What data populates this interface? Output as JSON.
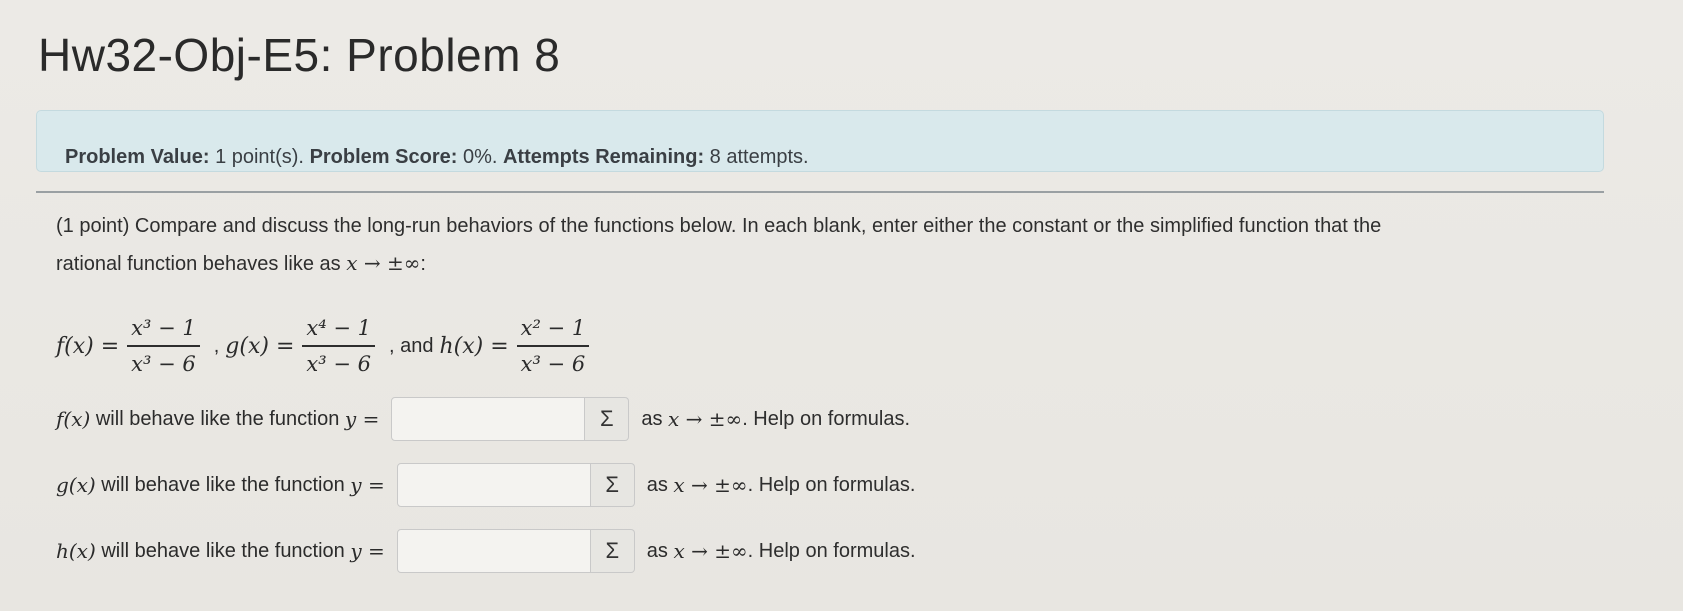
{
  "page_title": "Hw32-Obj-E5: Problem 8",
  "info": {
    "value_label": "Problem Value:",
    "value_text": "1 point(s).",
    "score_label": "Problem Score:",
    "score_text": "0%.",
    "attempts_label": "Attempts Remaining:",
    "attempts_text": "8 attempts."
  },
  "prompt": {
    "line1": "(1 point) Compare and discuss the long-run behaviors of the functions below. In each blank, enter either the constant or the simplified function that the",
    "line2_text": "rational function behaves like as ",
    "line2_math": "x → ±∞",
    "line2_end": ":"
  },
  "functions": {
    "f_lhs": "f(x) =",
    "f_num": "x³ − 1",
    "f_den": "x³ − 6",
    "g_lhs": "g(x) =",
    "g_num": "x⁴ − 1",
    "g_den": "x³ − 6",
    "h_lhs": "h(x) =",
    "h_num": "x² − 1",
    "h_den": "x³ − 6",
    "sep1": ",",
    "sep2": ", and"
  },
  "answers": [
    {
      "func": "f(x)",
      "label": "will behave like the function",
      "y_eq": "y =",
      "value": "",
      "sigma": "Σ",
      "as_text": "as",
      "limit": "x → ±∞",
      "help": ". Help on formulas."
    },
    {
      "func": "g(x)",
      "label": "will behave like the function",
      "y_eq": "y =",
      "value": "",
      "sigma": "Σ",
      "as_text": "as",
      "limit": "x → ±∞",
      "help": ". Help on formulas."
    },
    {
      "func": "h(x)",
      "label": "will behave like the function",
      "y_eq": "y =",
      "value": "",
      "sigma": "Σ",
      "as_text": "as",
      "limit": "x → ±∞",
      "help": ". Help on formulas."
    }
  ],
  "colors": {
    "info_bg": "#d9e9ec",
    "page_bg": "#eceae6"
  }
}
